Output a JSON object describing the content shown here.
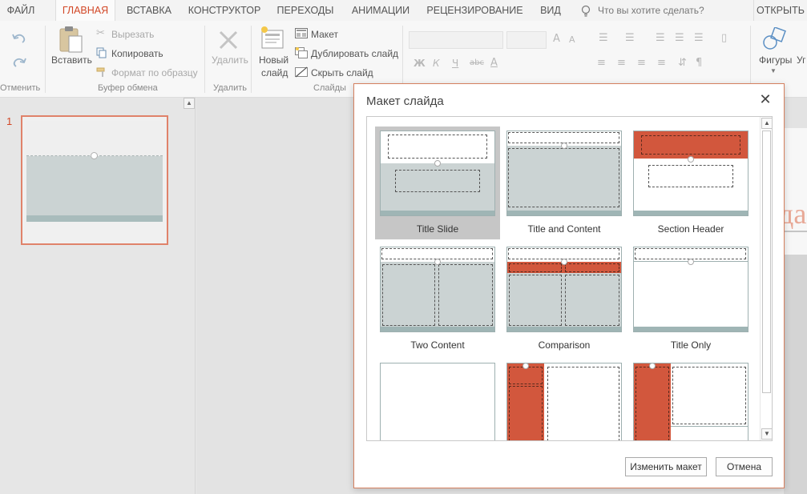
{
  "tabs": {
    "items": [
      "ФАЙЛ",
      "ГЛАВНАЯ",
      "ВСТАВКА",
      "КОНСТРУКТОР",
      "ПЕРЕХОДЫ",
      "АНИМАЦИИ",
      "РЕЦЕНЗИРОВАНИЕ",
      "ВИД"
    ],
    "active": "ГЛАВНАЯ",
    "tell_me_placeholder": "Что вы хотите сделать?",
    "open": "ОТКРЫТЬ"
  },
  "ribbon": {
    "undo_group_label": "Отменить",
    "clipboard": {
      "paste_label": "Вставить",
      "cut_label": "Вырезать",
      "copy_label": "Копировать",
      "format_painter_label": "Формат по образцу",
      "group_label": "Буфер обмена"
    },
    "delete": {
      "button_label": "Удалить",
      "group_label": "Удалить"
    },
    "slides": {
      "new_slide_line1": "Новый",
      "new_slide_line2": "слайд",
      "layout_label": "Макет",
      "duplicate_label": "Дублировать слайд",
      "hide_label": "Скрыть слайд",
      "group_label": "Слайды"
    },
    "font": {
      "bold": "Ж",
      "italic": "К",
      "underline": "Ч",
      "strike": "abc"
    },
    "drawing": {
      "shapes_label": "Фигуры",
      "cut_label": "Уг"
    }
  },
  "thumbnails": {
    "slide_number": "1"
  },
  "editor": {
    "peek_text": "да"
  },
  "dialog": {
    "title": "Макет слайда",
    "layouts": [
      {
        "name": "Title Slide",
        "selected": true
      },
      {
        "name": "Title and Content",
        "selected": false
      },
      {
        "name": "Section Header",
        "selected": false
      },
      {
        "name": "Two Content",
        "selected": false
      },
      {
        "name": "Comparison",
        "selected": false
      },
      {
        "name": "Title Only",
        "selected": false
      },
      {
        "name": "",
        "selected": false
      },
      {
        "name": "",
        "selected": false
      },
      {
        "name": "",
        "selected": false
      }
    ],
    "ok_button": "Изменить макет",
    "cancel_button": "Отмена"
  },
  "colors": {
    "accent": "#d24726",
    "theme_orange": "#d2573d",
    "theme_gray": "#cbd3d3",
    "theme_band": "#9fb5b5"
  }
}
